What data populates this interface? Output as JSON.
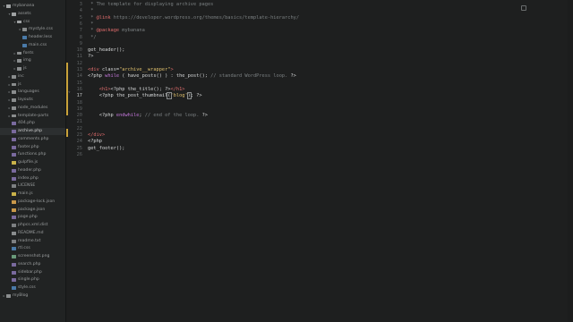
{
  "sidebar": {
    "items": [
      {
        "label": "mybanana",
        "kind": "folder",
        "open": true,
        "depth": 0
      },
      {
        "label": "assets",
        "kind": "folder",
        "open": true,
        "depth": 1
      },
      {
        "label": "css",
        "kind": "folder",
        "open": true,
        "depth": 2
      },
      {
        "label": "mystyle.css",
        "kind": "folder",
        "open": false,
        "depth": 3
      },
      {
        "label": "header.less",
        "kind": "css",
        "open": false,
        "depth": 3
      },
      {
        "label": "main.css",
        "kind": "css",
        "open": false,
        "depth": 3
      },
      {
        "label": "fonts",
        "kind": "folder",
        "open": false,
        "depth": 2
      },
      {
        "label": "img",
        "kind": "folder",
        "open": false,
        "depth": 2
      },
      {
        "label": "js",
        "kind": "folder",
        "open": false,
        "depth": 2
      },
      {
        "label": "inc",
        "kind": "folder",
        "open": false,
        "depth": 1
      },
      {
        "label": "js",
        "kind": "folder",
        "open": false,
        "depth": 1
      },
      {
        "label": "languages",
        "kind": "folder",
        "open": false,
        "depth": 1
      },
      {
        "label": "layouts",
        "kind": "folder",
        "open": false,
        "depth": 1
      },
      {
        "label": "node_modules",
        "kind": "folder",
        "open": false,
        "depth": 1
      },
      {
        "label": "template-parts",
        "kind": "folder",
        "open": false,
        "depth": 1
      },
      {
        "label": "404.php",
        "kind": "php",
        "depth": 1
      },
      {
        "label": "archive.php",
        "kind": "php",
        "depth": 1,
        "active": true
      },
      {
        "label": "comments.php",
        "kind": "php",
        "depth": 1
      },
      {
        "label": "footer.php",
        "kind": "php",
        "depth": 1
      },
      {
        "label": "functions.php",
        "kind": "php",
        "depth": 1
      },
      {
        "label": "gulpfile.js",
        "kind": "js",
        "depth": 1
      },
      {
        "label": "header.php",
        "kind": "php",
        "depth": 1
      },
      {
        "label": "index.php",
        "kind": "php",
        "depth": 1
      },
      {
        "label": "LICENSE",
        "kind": "txt",
        "depth": 1
      },
      {
        "label": "main.js",
        "kind": "js",
        "depth": 1
      },
      {
        "label": "package-lock.json",
        "kind": "json",
        "depth": 1
      },
      {
        "label": "package.json",
        "kind": "json",
        "depth": 1
      },
      {
        "label": "page.php",
        "kind": "php",
        "depth": 1
      },
      {
        "label": "phpcs.xml.dist",
        "kind": "txt",
        "depth": 1
      },
      {
        "label": "README.md",
        "kind": "md",
        "depth": 1
      },
      {
        "label": "readme.txt",
        "kind": "txt",
        "depth": 1
      },
      {
        "label": "rtl.css",
        "kind": "css",
        "depth": 1
      },
      {
        "label": "screenshot.png",
        "kind": "img",
        "depth": 1
      },
      {
        "label": "search.php",
        "kind": "php",
        "depth": 1
      },
      {
        "label": "sidebar.php",
        "kind": "php",
        "depth": 1
      },
      {
        "label": "single.php",
        "kind": "php",
        "depth": 1
      },
      {
        "label": "style.css",
        "kind": "css",
        "depth": 1
      },
      {
        "label": "myBlog",
        "kind": "folder",
        "open": false,
        "depth": 0
      }
    ]
  },
  "editor": {
    "current_line": 17,
    "lines": [
      {
        "n": "3",
        "segs": [
          {
            "t": " * The template for displaying archive pages",
            "c": "comment"
          }
        ]
      },
      {
        "n": "4",
        "segs": [
          {
            "t": " *",
            "c": "comment"
          }
        ]
      },
      {
        "n": "5",
        "segs": [
          {
            "t": " * ",
            "c": "comment"
          },
          {
            "t": "@link",
            "c": "tag"
          },
          {
            "t": " https://developer.wordpress.org/themes/basics/template-hierarchy/",
            "c": "comment"
          }
        ]
      },
      {
        "n": "6",
        "segs": [
          {
            "t": " *",
            "c": "comment"
          }
        ]
      },
      {
        "n": "7",
        "segs": [
          {
            "t": " * ",
            "c": "comment"
          },
          {
            "t": "@package",
            "c": "tag"
          },
          {
            "t": " mybanana",
            "c": "comment"
          }
        ]
      },
      {
        "n": "8",
        "segs": [
          {
            "t": " */",
            "c": "comment"
          }
        ]
      },
      {
        "n": "9",
        "segs": []
      },
      {
        "n": "10",
        "segs": [
          {
            "t": "get_header();",
            "c": "plain"
          }
        ]
      },
      {
        "n": "11",
        "segs": [
          {
            "t": "?>",
            "c": "plain"
          }
        ]
      },
      {
        "n": "12",
        "segs": []
      },
      {
        "n": "13",
        "segs": [
          {
            "t": "<div ",
            "c": "tag"
          },
          {
            "t": "class=",
            "c": "attr"
          },
          {
            "t": "\"archive__wrapper\"",
            "c": "string"
          },
          {
            "t": ">",
            "c": "tag"
          }
        ]
      },
      {
        "n": "14",
        "segs": [
          {
            "t": "<?php ",
            "c": "plain"
          },
          {
            "t": "while",
            "c": "keyword"
          },
          {
            "t": " ( have_posts() ) : the_post(); ",
            "c": "plain"
          },
          {
            "t": "// standard WordPress loop.",
            "c": "comment"
          },
          {
            "t": " ?>",
            "c": "plain"
          }
        ]
      },
      {
        "n": "15",
        "segs": []
      },
      {
        "n": "16",
        "segs": [
          {
            "t": "    <h1>",
            "c": "tag"
          },
          {
            "t": "<?php the_title(); ?>",
            "c": "plain"
          },
          {
            "t": "</h1>",
            "c": "tag"
          }
        ]
      },
      {
        "n": "17",
        "segs": [
          {
            "t": "    <?php the_post_thumbnail",
            "c": "plain"
          },
          {
            "t": "(",
            "c": "bracket"
          },
          {
            "t": "'blog'",
            "c": "string"
          },
          {
            "t": ")",
            "c": "bracket"
          },
          {
            "t": "; ?>",
            "c": "plain"
          }
        ]
      },
      {
        "n": "18",
        "segs": []
      },
      {
        "n": "19",
        "segs": []
      },
      {
        "n": "20",
        "segs": [
          {
            "t": "    <?php ",
            "c": "plain"
          },
          {
            "t": "endwhile",
            "c": "keyword"
          },
          {
            "t": "; ",
            "c": "plain"
          },
          {
            "t": "// end of the loop.",
            "c": "comment"
          },
          {
            "t": " ?>",
            "c": "plain"
          }
        ]
      },
      {
        "n": "21",
        "segs": []
      },
      {
        "n": "22",
        "segs": []
      },
      {
        "n": "23",
        "segs": [
          {
            "t": "</div>",
            "c": "tag"
          }
        ]
      },
      {
        "n": "24",
        "segs": [
          {
            "t": "<?php",
            "c": "plain"
          }
        ]
      },
      {
        "n": "25",
        "segs": [
          {
            "t": "get_footer();",
            "c": "plain"
          }
        ]
      },
      {
        "n": "26",
        "segs": []
      }
    ]
  }
}
